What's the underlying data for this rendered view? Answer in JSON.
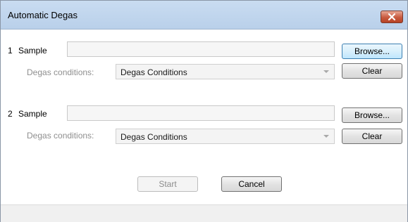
{
  "window": {
    "title": "Automatic Degas",
    "close_icon": "close-icon"
  },
  "rows": [
    {
      "number": "1",
      "sample_label": "Sample",
      "sample_value": "",
      "browse_label": "Browse...",
      "conditions_label": "Degas conditions:",
      "conditions_value": "Degas Conditions",
      "clear_label": "Clear"
    },
    {
      "number": "2",
      "sample_label": "Sample",
      "sample_value": "",
      "browse_label": "Browse...",
      "conditions_label": "Degas conditions:",
      "conditions_value": "Degas Conditions",
      "clear_label": "Clear"
    }
  ],
  "actions": {
    "start_label": "Start",
    "cancel_label": "Cancel"
  },
  "colors": {
    "titlebar": "#c9dcf1",
    "close_button": "#c85a3f",
    "focus_border": "#3c7fb1"
  }
}
